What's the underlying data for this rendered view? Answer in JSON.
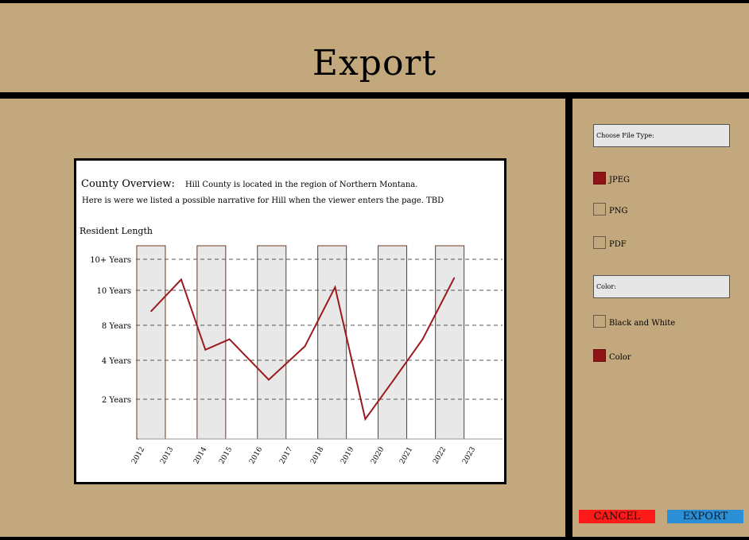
{
  "page": {
    "title": "Export"
  },
  "preview": {
    "overview_label": "County Overview:",
    "overview_text": "Hill County is located in the region of Northern Montana.",
    "narrative": "Here is were we listed a possible narrative for Hill when the viewer enters the page. TBD"
  },
  "chart_data": {
    "type": "line",
    "ylabel": "Resident Length",
    "y_categories": [
      "2 Years",
      "4 Years",
      "8 Years",
      "10 Years",
      "10+ Years"
    ],
    "x_ticks": [
      "2012",
      "2013",
      "2014",
      "2015",
      "2016",
      "2017",
      "2018",
      "2019",
      "2020",
      "2021",
      "2022",
      "2023"
    ],
    "series": [
      {
        "color": "#9a1a1e",
        "points": [
          {
            "x": 2012.5,
            "y": 3.4
          },
          {
            "x": 2013.5,
            "y": 4.35
          },
          {
            "x": 2014.3,
            "y": 2.3
          },
          {
            "x": 2015.1,
            "y": 2.6
          },
          {
            "x": 2016.4,
            "y": 1.5
          },
          {
            "x": 2017.6,
            "y": 2.4
          },
          {
            "x": 2018.6,
            "y": 4.1
          },
          {
            "x": 2019.6,
            "y": 0.5
          },
          {
            "x": 2020.5,
            "y": 1.45
          },
          {
            "x": 2021.5,
            "y": 2.6
          },
          {
            "x": 2022.55,
            "y": 4.4
          }
        ]
      }
    ],
    "bars_color": "#e8e8e8",
    "grid": "dashed"
  },
  "panel": {
    "file_type_label": "Choose File Type:",
    "file_types": [
      {
        "label": "JPEG",
        "checked": true
      },
      {
        "label": "PNG",
        "checked": false
      },
      {
        "label": "PDF",
        "checked": false
      }
    ],
    "color_label": "Color:",
    "color_options": [
      {
        "label": "Black and White",
        "checked": false
      },
      {
        "label": "Color",
        "checked": true
      }
    ]
  },
  "buttons": {
    "cancel": "CANCEL",
    "export": "EXPORT"
  },
  "colors": {
    "background": "#c4a87d",
    "accent_red": "#8f1418",
    "cancel": "#ff1a1a",
    "export": "#2b8fd6"
  }
}
